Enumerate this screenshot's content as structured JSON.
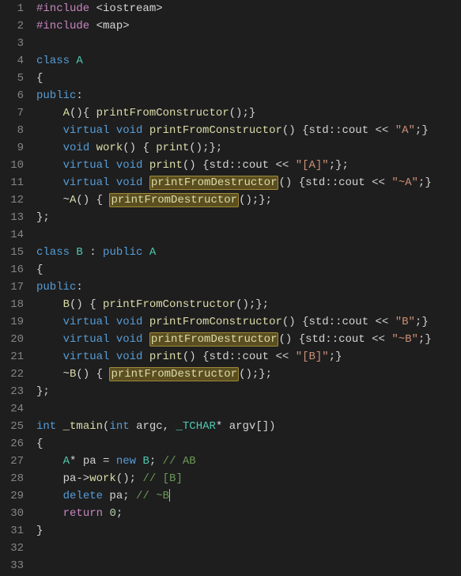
{
  "chart_data": null,
  "highlight_term": "printFromDestructor",
  "lines": [
    {
      "num": "1",
      "tokens": [
        {
          "c": "pre",
          "t": "#include"
        },
        {
          "c": "def",
          "t": " <iostream>"
        }
      ]
    },
    {
      "num": "2",
      "tokens": [
        {
          "c": "pre",
          "t": "#include"
        },
        {
          "c": "def",
          "t": " <map>"
        }
      ]
    },
    {
      "num": "3",
      "tokens": []
    },
    {
      "num": "4",
      "tokens": [
        {
          "c": "kw",
          "t": "class"
        },
        {
          "c": "def",
          "t": " "
        },
        {
          "c": "type",
          "t": "A"
        }
      ]
    },
    {
      "num": "5",
      "tokens": [
        {
          "c": "def",
          "t": "{"
        }
      ]
    },
    {
      "num": "6",
      "tokens": [
        {
          "c": "kw",
          "t": "public"
        },
        {
          "c": "def",
          "t": ":"
        }
      ]
    },
    {
      "num": "7",
      "tokens": [
        {
          "c": "def",
          "t": "    "
        },
        {
          "c": "func",
          "t": "A"
        },
        {
          "c": "def",
          "t": "(){ "
        },
        {
          "c": "func",
          "t": "printFromConstructor"
        },
        {
          "c": "def",
          "t": "();}"
        }
      ]
    },
    {
      "num": "8",
      "tokens": [
        {
          "c": "def",
          "t": "    "
        },
        {
          "c": "kw",
          "t": "virtual"
        },
        {
          "c": "def",
          "t": " "
        },
        {
          "c": "kw",
          "t": "void"
        },
        {
          "c": "def",
          "t": " "
        },
        {
          "c": "func",
          "t": "printFromConstructor"
        },
        {
          "c": "def",
          "t": "() {std::cout << "
        },
        {
          "c": "str",
          "t": "\"A\""
        },
        {
          "c": "def",
          "t": ";}"
        }
      ]
    },
    {
      "num": "9",
      "tokens": [
        {
          "c": "def",
          "t": "    "
        },
        {
          "c": "kw",
          "t": "void"
        },
        {
          "c": "def",
          "t": " "
        },
        {
          "c": "func",
          "t": "work"
        },
        {
          "c": "def",
          "t": "() { "
        },
        {
          "c": "func",
          "t": "print"
        },
        {
          "c": "def",
          "t": "();};"
        }
      ]
    },
    {
      "num": "10",
      "tokens": [
        {
          "c": "def",
          "t": "    "
        },
        {
          "c": "kw",
          "t": "virtual"
        },
        {
          "c": "def",
          "t": " "
        },
        {
          "c": "kw",
          "t": "void"
        },
        {
          "c": "def",
          "t": " "
        },
        {
          "c": "func",
          "t": "print"
        },
        {
          "c": "def",
          "t": "() {std::cout << "
        },
        {
          "c": "str",
          "t": "\"[A]\""
        },
        {
          "c": "def",
          "t": ";};"
        }
      ]
    },
    {
      "num": "11",
      "tokens": [
        {
          "c": "def",
          "t": "    "
        },
        {
          "c": "kw",
          "t": "virtual"
        },
        {
          "c": "def",
          "t": " "
        },
        {
          "c": "kw",
          "t": "void"
        },
        {
          "c": "def",
          "t": " "
        },
        {
          "c": "func",
          "t": "printFromDestructor",
          "hl": true
        },
        {
          "c": "def",
          "t": "() {std::cout << "
        },
        {
          "c": "str",
          "t": "\"~A\""
        },
        {
          "c": "def",
          "t": ";}"
        }
      ]
    },
    {
      "num": "12",
      "tokens": [
        {
          "c": "def",
          "t": "    ~"
        },
        {
          "c": "func",
          "t": "A"
        },
        {
          "c": "def",
          "t": "() { "
        },
        {
          "c": "func",
          "t": "printFromDestructor",
          "hl": true
        },
        {
          "c": "def",
          "t": "();};"
        }
      ]
    },
    {
      "num": "13",
      "tokens": [
        {
          "c": "def",
          "t": "};"
        }
      ]
    },
    {
      "num": "14",
      "tokens": []
    },
    {
      "num": "15",
      "tokens": [
        {
          "c": "kw",
          "t": "class"
        },
        {
          "c": "def",
          "t": " "
        },
        {
          "c": "type",
          "t": "B"
        },
        {
          "c": "def",
          "t": " : "
        },
        {
          "c": "kw",
          "t": "public"
        },
        {
          "c": "def",
          "t": " "
        },
        {
          "c": "type",
          "t": "A"
        }
      ]
    },
    {
      "num": "16",
      "tokens": [
        {
          "c": "def",
          "t": "{"
        }
      ]
    },
    {
      "num": "17",
      "tokens": [
        {
          "c": "kw",
          "t": "public"
        },
        {
          "c": "def",
          "t": ":"
        }
      ]
    },
    {
      "num": "18",
      "tokens": [
        {
          "c": "def",
          "t": "    "
        },
        {
          "c": "func",
          "t": "B"
        },
        {
          "c": "def",
          "t": "() { "
        },
        {
          "c": "func",
          "t": "printFromConstructor"
        },
        {
          "c": "def",
          "t": "();};"
        }
      ]
    },
    {
      "num": "19",
      "tokens": [
        {
          "c": "def",
          "t": "    "
        },
        {
          "c": "kw",
          "t": "virtual"
        },
        {
          "c": "def",
          "t": " "
        },
        {
          "c": "kw",
          "t": "void"
        },
        {
          "c": "def",
          "t": " "
        },
        {
          "c": "func",
          "t": "printFromConstructor"
        },
        {
          "c": "def",
          "t": "() {std::cout << "
        },
        {
          "c": "str",
          "t": "\"B\""
        },
        {
          "c": "def",
          "t": ";}"
        }
      ]
    },
    {
      "num": "20",
      "tokens": [
        {
          "c": "def",
          "t": "    "
        },
        {
          "c": "kw",
          "t": "virtual"
        },
        {
          "c": "def",
          "t": " "
        },
        {
          "c": "kw",
          "t": "void"
        },
        {
          "c": "def",
          "t": " "
        },
        {
          "c": "func",
          "t": "printFromDestructor",
          "hl": true
        },
        {
          "c": "def",
          "t": "() {std::cout << "
        },
        {
          "c": "str",
          "t": "\"~B\""
        },
        {
          "c": "def",
          "t": ";}"
        }
      ]
    },
    {
      "num": "21",
      "tokens": [
        {
          "c": "def",
          "t": "    "
        },
        {
          "c": "kw",
          "t": "virtual"
        },
        {
          "c": "def",
          "t": " "
        },
        {
          "c": "kw",
          "t": "void"
        },
        {
          "c": "def",
          "t": " "
        },
        {
          "c": "func",
          "t": "print"
        },
        {
          "c": "def",
          "t": "() {std::cout << "
        },
        {
          "c": "str",
          "t": "\"[B]\""
        },
        {
          "c": "def",
          "t": ";}"
        }
      ]
    },
    {
      "num": "22",
      "tokens": [
        {
          "c": "def",
          "t": "    ~"
        },
        {
          "c": "func",
          "t": "B"
        },
        {
          "c": "def",
          "t": "() { "
        },
        {
          "c": "func",
          "t": "printFromDestructor",
          "hl": true
        },
        {
          "c": "def",
          "t": "();};"
        }
      ]
    },
    {
      "num": "23",
      "tokens": [
        {
          "c": "def",
          "t": "};"
        }
      ]
    },
    {
      "num": "24",
      "tokens": []
    },
    {
      "num": "25",
      "tokens": [
        {
          "c": "kw",
          "t": "int"
        },
        {
          "c": "def",
          "t": " "
        },
        {
          "c": "func",
          "t": "_tmain"
        },
        {
          "c": "def",
          "t": "("
        },
        {
          "c": "kw",
          "t": "int"
        },
        {
          "c": "def",
          "t": " argc, "
        },
        {
          "c": "type",
          "t": "_TCHAR"
        },
        {
          "c": "def",
          "t": "* argv[])"
        }
      ]
    },
    {
      "num": "26",
      "tokens": [
        {
          "c": "def",
          "t": "{"
        }
      ]
    },
    {
      "num": "27",
      "tokens": [
        {
          "c": "def",
          "t": "    "
        },
        {
          "c": "type",
          "t": "A"
        },
        {
          "c": "def",
          "t": "* pa = "
        },
        {
          "c": "kw",
          "t": "new"
        },
        {
          "c": "def",
          "t": " "
        },
        {
          "c": "type",
          "t": "B"
        },
        {
          "c": "def",
          "t": "; "
        },
        {
          "c": "com",
          "t": "// AB"
        }
      ]
    },
    {
      "num": "28",
      "tokens": [
        {
          "c": "def",
          "t": "    pa->"
        },
        {
          "c": "func",
          "t": "work"
        },
        {
          "c": "def",
          "t": "(); "
        },
        {
          "c": "com",
          "t": "// [B]"
        }
      ]
    },
    {
      "num": "29",
      "tokens": [
        {
          "c": "def",
          "t": "    "
        },
        {
          "c": "kw",
          "t": "delete"
        },
        {
          "c": "def",
          "t": " pa; "
        },
        {
          "c": "com",
          "t": "// ~B"
        }
      ],
      "cursor": true
    },
    {
      "num": "30",
      "tokens": [
        {
          "c": "def",
          "t": "    "
        },
        {
          "c": "pre",
          "t": "return"
        },
        {
          "c": "def",
          "t": " "
        },
        {
          "c": "num",
          "t": "0"
        },
        {
          "c": "def",
          "t": ";"
        }
      ]
    },
    {
      "num": "31",
      "tokens": [
        {
          "c": "def",
          "t": "}"
        }
      ]
    },
    {
      "num": "32",
      "tokens": []
    },
    {
      "num": "33",
      "tokens": []
    }
  ]
}
